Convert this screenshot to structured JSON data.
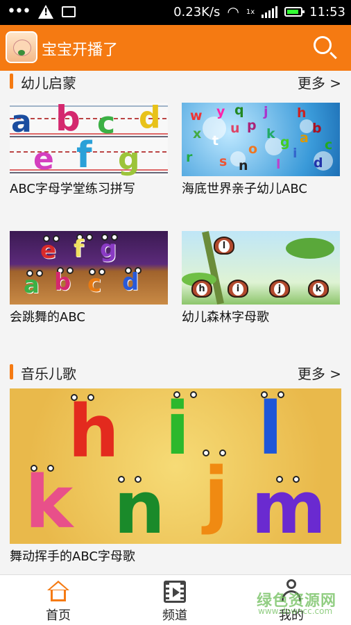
{
  "status_bar": {
    "net_speed": "0.23K/s",
    "time": "11:53",
    "signal_label": "1x"
  },
  "app_bar": {
    "title": "宝宝开播了"
  },
  "sections": [
    {
      "title": "幼儿启蒙",
      "more": "更多 >",
      "items": [
        {
          "caption": "ABC字母学堂练习拼写"
        },
        {
          "caption": "海底世界亲子幼儿ABC"
        },
        {
          "caption": "会跳舞的ABC"
        },
        {
          "caption": "幼儿森林字母歌"
        }
      ]
    },
    {
      "title": "音乐儿歌",
      "more": "更多 >",
      "items": [
        {
          "caption": "舞动挥手的ABC字母歌"
        }
      ]
    }
  ],
  "thumb_letters": {
    "t1_row1": [
      "a",
      "b",
      "c",
      "d"
    ],
    "t1_row2": [
      "e",
      "f",
      "g"
    ],
    "t2": [
      "w",
      "y",
      "q",
      "j",
      "h",
      "x",
      "u",
      "p",
      "k",
      "b",
      "t",
      "g",
      "a",
      "s",
      "o",
      "c",
      "r",
      "n",
      "l",
      "d",
      "i"
    ],
    "t3": [
      "e",
      "f",
      "g",
      "a",
      "b",
      "c",
      "d"
    ],
    "t4": [
      "l",
      "h",
      "i",
      "j",
      "k"
    ],
    "t5": [
      "h",
      "i",
      "l",
      "k",
      "n",
      "j",
      "m"
    ]
  },
  "bottom_nav": [
    {
      "label": "首页",
      "icon": "home-icon",
      "active": true
    },
    {
      "label": "频道",
      "icon": "film-icon",
      "active": false
    },
    {
      "label": "我的",
      "icon": "user-icon",
      "active": false
    }
  ],
  "watermark": {
    "text": "绿色资源网",
    "sub": "www.downcc.com"
  },
  "colors": {
    "accent": "#f57a12",
    "status_bg": "#000000"
  }
}
